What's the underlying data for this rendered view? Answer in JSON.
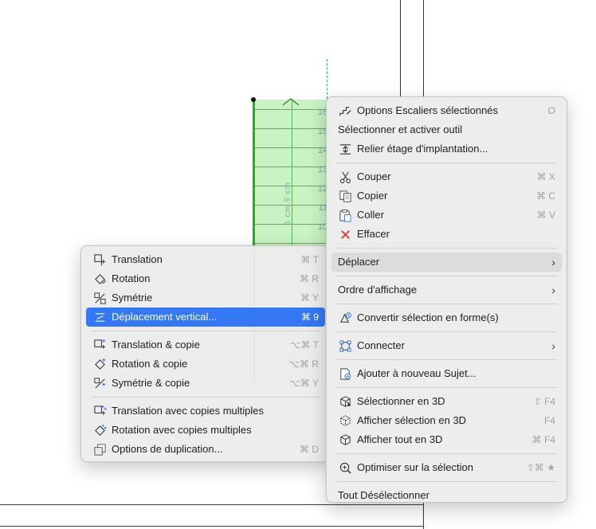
{
  "drawing": {
    "step_numbers": [
      "16",
      "15",
      "14",
      "13",
      "12",
      "11",
      "10"
    ],
    "vertical_label": "5 cm 5 cm"
  },
  "main_menu": {
    "items": [
      {
        "label": "Options Escaliers sélectionnés",
        "shortcut": "O",
        "icon": "stair-options-icon"
      },
      {
        "label": "Sélectionner et activer outil",
        "shortcut": "",
        "icon": ""
      },
      {
        "label": "Relier étage d'implantation...",
        "shortcut": "",
        "icon": "link-story-icon"
      },
      {
        "label": "Couper",
        "shortcut": "⌘ X",
        "icon": "scissors-icon"
      },
      {
        "label": "Copier",
        "shortcut": "⌘ C",
        "icon": "copy-icon"
      },
      {
        "label": "Coller",
        "shortcut": "⌘ V",
        "icon": "paste-icon"
      },
      {
        "label": "Effacer",
        "shortcut": "",
        "icon": "delete-x-icon"
      },
      {
        "label": "Déplacer",
        "shortcut": "",
        "icon": ""
      },
      {
        "label": "Ordre d'affichage",
        "shortcut": "",
        "icon": ""
      },
      {
        "label": "Convertir sélection en forme(s)",
        "shortcut": "",
        "icon": "convert-shape-icon"
      },
      {
        "label": "Connecter",
        "shortcut": "",
        "icon": "connect-icon"
      },
      {
        "label": "Ajouter à nouveau Sujet...",
        "shortcut": "",
        "icon": "add-topic-icon"
      },
      {
        "label": "Sélectionner en 3D",
        "shortcut": "⇧ F4",
        "icon": "select-3d-icon"
      },
      {
        "label": "Afficher sélection en 3D",
        "shortcut": "F4",
        "icon": "show-selection-3d-icon"
      },
      {
        "label": "Afficher tout en 3D",
        "shortcut": "⌘ F4",
        "icon": "show-all-3d-icon"
      },
      {
        "label": "Optimiser sur la sélection",
        "shortcut": "⇧⌘ ★",
        "icon": "zoom-fit-icon"
      },
      {
        "label": "Tout Désélectionner",
        "shortcut": "",
        "icon": ""
      }
    ]
  },
  "sub_menu": {
    "items": [
      {
        "label": "Translation",
        "shortcut": "⌘ T",
        "icon": "translation-icon"
      },
      {
        "label": "Rotation",
        "shortcut": "⌘ R",
        "icon": "rotation-icon"
      },
      {
        "label": "Symétrie",
        "shortcut": "⌘ Y",
        "icon": "mirror-icon"
      },
      {
        "label": "Déplacement vertical...",
        "shortcut": "⌘ 9",
        "icon": "vertical-move-icon"
      },
      {
        "label": "Translation & copie",
        "shortcut": "⌥⌘ T",
        "icon": "translation-copy-icon"
      },
      {
        "label": "Rotation & copie",
        "shortcut": "⌥⌘ R",
        "icon": "rotation-copy-icon"
      },
      {
        "label": "Symétrie & copie",
        "shortcut": "⌥⌘ Y",
        "icon": "mirror-copy-icon"
      },
      {
        "label": "Translation avec copies multiples",
        "shortcut": "",
        "icon": "translation-multi-icon"
      },
      {
        "label": "Rotation avec copies multiples",
        "shortcut": "",
        "icon": "rotation-multi-icon"
      },
      {
        "label": "Options de duplication...",
        "shortcut": "⌘ D",
        "icon": "duplicate-options-icon"
      }
    ]
  },
  "colors": {
    "highlight": "#3478f6",
    "stair_fill": "#c9f3c2",
    "stair_border": "#22b022",
    "delete_red": "#e0362b"
  }
}
